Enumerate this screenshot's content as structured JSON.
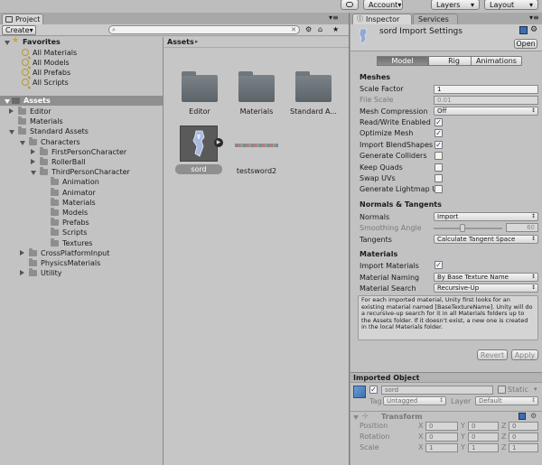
{
  "topbar": {
    "account_label": "Account",
    "layers_label": "Layers",
    "layout_label": "Layout"
  },
  "project": {
    "tab_title": "Project",
    "create_label": "Create",
    "favorites": {
      "title": "Favorites",
      "items": [
        "All Materials",
        "All Models",
        "All Prefabs",
        "All Scripts"
      ]
    },
    "assets_root": "Assets",
    "tree": [
      {
        "label": "Editor",
        "depth": 1,
        "expanded": false
      },
      {
        "label": "Materials",
        "depth": 1,
        "expanded": null
      },
      {
        "label": "Standard Assets",
        "depth": 1,
        "expanded": true
      },
      {
        "label": "Characters",
        "depth": 2,
        "expanded": true
      },
      {
        "label": "FirstPersonCharacter",
        "depth": 3,
        "expanded": false
      },
      {
        "label": "RollerBall",
        "depth": 3,
        "expanded": false
      },
      {
        "label": "ThirdPersonCharacter",
        "depth": 3,
        "expanded": true
      },
      {
        "label": "Animation",
        "depth": 4,
        "expanded": null
      },
      {
        "label": "Animator",
        "depth": 4,
        "expanded": null
      },
      {
        "label": "Materials",
        "depth": 4,
        "expanded": null
      },
      {
        "label": "Models",
        "depth": 4,
        "expanded": null
      },
      {
        "label": "Prefabs",
        "depth": 4,
        "expanded": null
      },
      {
        "label": "Scripts",
        "depth": 4,
        "expanded": null
      },
      {
        "label": "Textures",
        "depth": 4,
        "expanded": null
      },
      {
        "label": "CrossPlatformInput",
        "depth": 2,
        "expanded": false
      },
      {
        "label": "PhysicsMaterials",
        "depth": 2,
        "expanded": null
      },
      {
        "label": "Utility",
        "depth": 2,
        "expanded": false
      }
    ],
    "breadcrumb": "Assets",
    "grid_items": [
      {
        "label": "Editor"
      },
      {
        "label": "Materials"
      },
      {
        "label": "Standard A..."
      },
      {
        "label": "sord"
      },
      {
        "label": "testsword2"
      }
    ]
  },
  "inspector": {
    "tab_inspector": "Inspector",
    "tab_services": "Services",
    "title": "sord Import Settings",
    "open_label": "Open",
    "tabs": [
      "Model",
      "Rig",
      "Animations"
    ],
    "meshes_header": "Meshes",
    "scale_factor_label": "Scale Factor",
    "scale_factor_value": "1",
    "file_scale_label": "File Scale",
    "file_scale_value": "0.01",
    "mesh_compression_label": "Mesh Compression",
    "mesh_compression_value": "Off",
    "checks": [
      {
        "label": "Read/Write Enabled",
        "checked": true
      },
      {
        "label": "Optimize Mesh",
        "checked": true
      },
      {
        "label": "Import BlendShapes",
        "checked": true
      },
      {
        "label": "Generate Colliders",
        "checked": false
      },
      {
        "label": "Keep Quads",
        "checked": false
      },
      {
        "label": "Swap UVs",
        "checked": false
      },
      {
        "label": "Generate Lightmap U",
        "checked": false
      }
    ],
    "normals_header": "Normals & Tangents",
    "normals_label": "Normals",
    "normals_value": "Import",
    "smoothing_label": "Smoothing Angle",
    "smoothing_value": "60",
    "tangents_label": "Tangents",
    "tangents_value": "Calculate Tangent Space",
    "materials_header": "Materials",
    "import_materials_label": "Import Materials",
    "material_naming_label": "Material Naming",
    "material_naming_value": "By Base Texture Name",
    "material_search_label": "Material Search",
    "material_search_value": "Recursive-Up",
    "help_text": "For each imported material, Unity first looks for an existing material named [BaseTextureName]. Unity will do a recursive-up search for it in all Materials folders up to the Assets folder. If it doesn't exist, a new one is created in the local Materials folder.",
    "revert_label": "Revert",
    "apply_label": "Apply",
    "imported_object_header": "Imported Object",
    "object_name": "sord",
    "static_label": "Static",
    "tag_label": "Tag",
    "tag_value": "Untagged",
    "layer_label": "Layer",
    "layer_value": "Default",
    "transform_label": "Transform",
    "transform_rows": [
      {
        "label": "Position",
        "x": "0",
        "y": "0",
        "z": "0"
      },
      {
        "label": "Rotation",
        "x": "0",
        "y": "0",
        "z": "0"
      },
      {
        "label": "Scale",
        "x": "1",
        "y": "1",
        "z": "1"
      }
    ],
    "axis_x": "X",
    "axis_y": "Y",
    "axis_z": "Z"
  }
}
